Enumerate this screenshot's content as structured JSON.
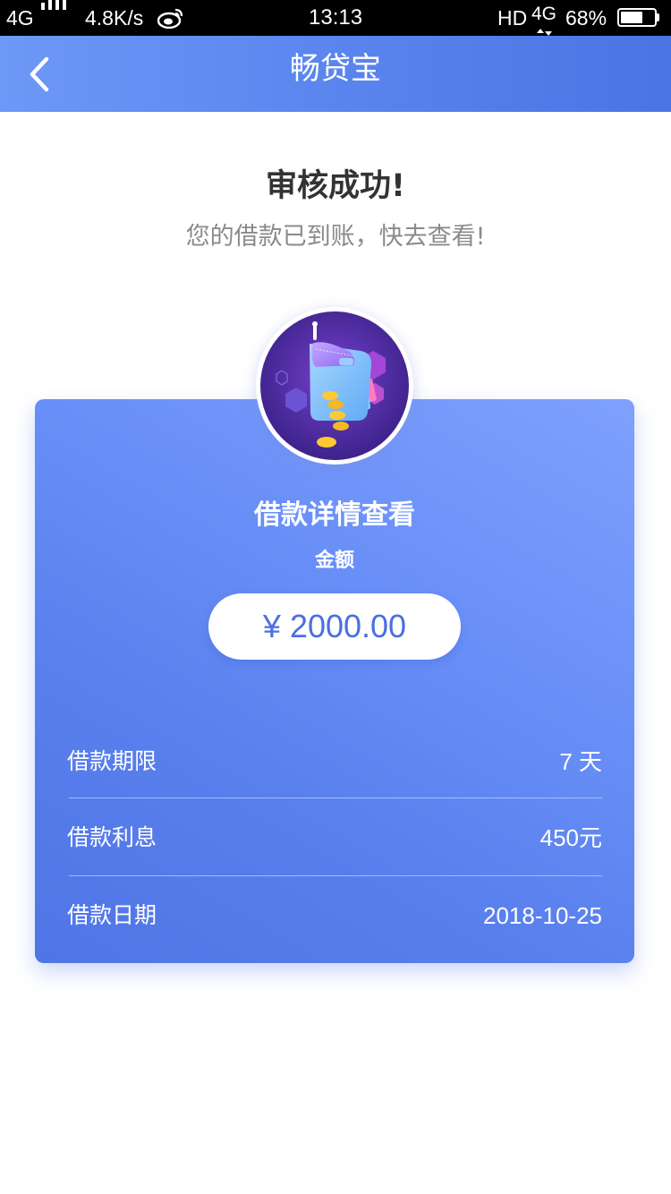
{
  "status_bar": {
    "network_left": "4G",
    "speed": "4.8K/s",
    "time": "13:13",
    "hd": "HD",
    "network_right": "4G",
    "battery": "68%",
    "battery_level": 0.68
  },
  "nav": {
    "title": "畅贷宝",
    "back_icon": "chevron-left-icon"
  },
  "result": {
    "title": "审核成功!",
    "subtitle": "您的借款已到账，快去查看!"
  },
  "card": {
    "title": "借款详情查看",
    "amount_label": "金额",
    "amount": "¥ 2000.00",
    "details": [
      {
        "label": "借款期限",
        "value": "7 天"
      },
      {
        "label": "借款利息",
        "value": "450元"
      },
      {
        "label": "借款日期",
        "value": "2018-10-25"
      }
    ]
  },
  "colors": {
    "nav_gradient_start": "#6d98f7",
    "nav_gradient_end": "#4a74e4",
    "card_gradient_start": "#7ea1fe",
    "card_gradient_end": "#4f75e6",
    "amount_text": "#4a6fe3",
    "title_text": "#333333",
    "subtitle_text": "#8a8a8a"
  }
}
